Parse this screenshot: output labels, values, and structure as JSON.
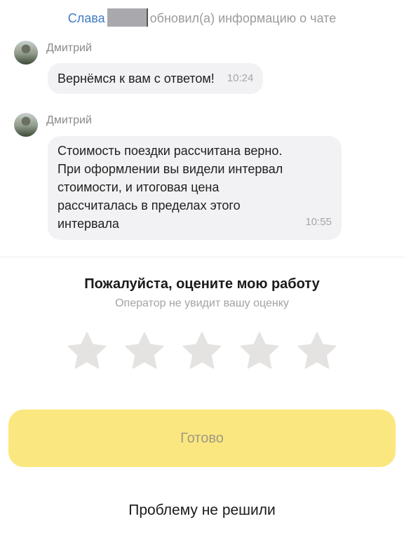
{
  "system_notice": {
    "name": "Слава",
    "text": "обновил(а) информацию о чате"
  },
  "messages": [
    {
      "author": "Дмитрий",
      "text": "Вернёмся к вам с ответом!",
      "time": "10:24"
    },
    {
      "author": "Дмитрий",
      "lines": [
        "Стоимость поездки рассчитана верно.",
        "При оформлении вы видели интервал",
        "стоимости, и итоговая цена",
        "рассчиталась в пределах этого",
        "интервала"
      ],
      "time": "10:55"
    }
  ],
  "rating": {
    "title": "Пожалуйста, оцените мою работу",
    "subtitle": "Оператор не увидит вашу оценку",
    "max_stars": 5,
    "selected": 0,
    "star_color": "#e4e3e1"
  },
  "actions": {
    "done_label": "Готово",
    "done_color": "#fbe77f",
    "problem_label": "Проблему не решили"
  }
}
